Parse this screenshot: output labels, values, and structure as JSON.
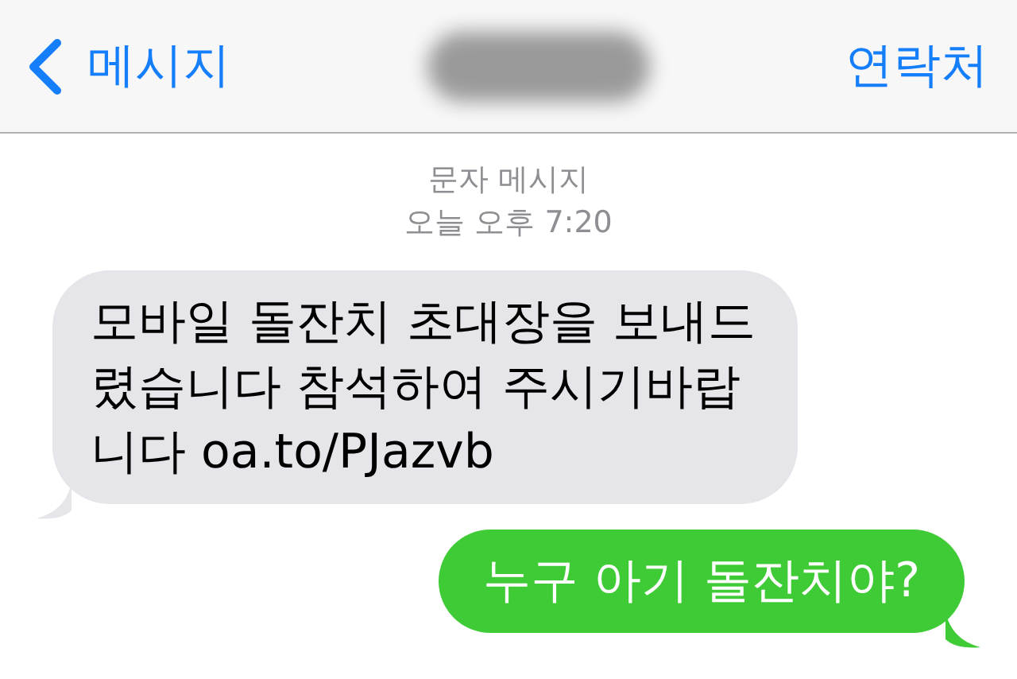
{
  "nav_bar": {
    "back_label": "메시지",
    "contact_label": "연락처",
    "title_blurred": true
  },
  "thread_header": {
    "service": "문자 메시지",
    "timestamp": "오늘 오후 7:20"
  },
  "messages": [
    {
      "kind": "received",
      "lines": [
        "모바일 돌잔치 초대장을 보내드",
        "렸습니다  참석하여 주시기바랍",
        "니다  oa.to/PJazvb"
      ]
    },
    {
      "kind": "sent",
      "lines": [
        "누구 아기 돌잔치야?"
      ]
    }
  ]
}
